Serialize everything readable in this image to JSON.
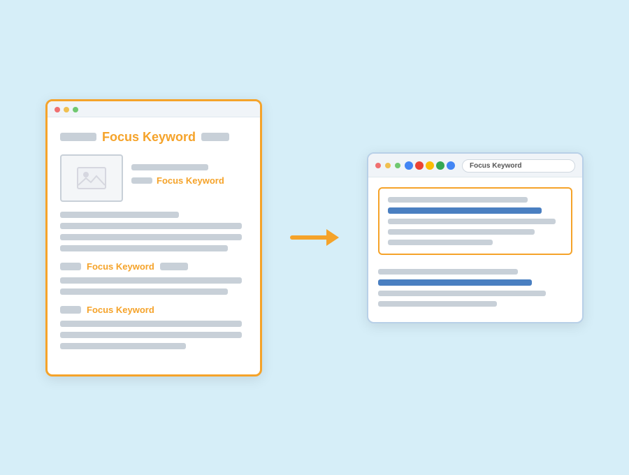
{
  "left_window": {
    "title_keyword": "Focus Keyword",
    "caption_keyword": "Focus Keyword",
    "heading1_keyword": "Focus Keyword",
    "heading2_keyword": "Focus Keyword"
  },
  "right_window": {
    "search_text": "Focus Keyword"
  },
  "arrow": "→"
}
